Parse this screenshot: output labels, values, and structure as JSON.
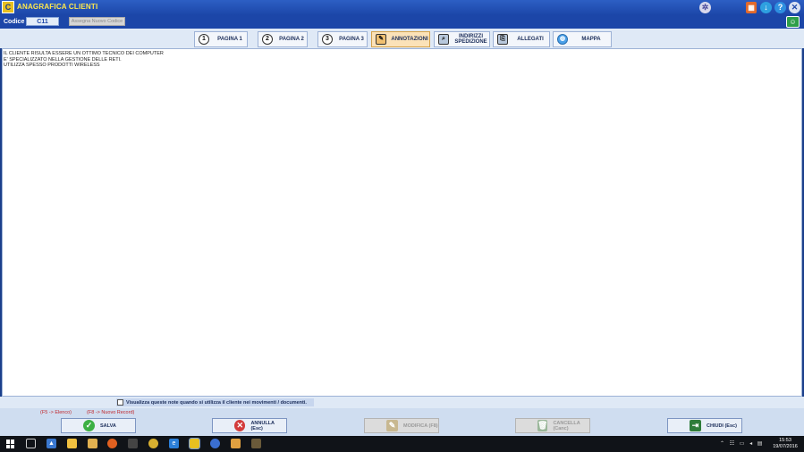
{
  "window": {
    "title": "ANAGRAFICA CLIENTI",
    "logo": "C"
  },
  "codebar": {
    "label": "Codice",
    "code_value": "C11",
    "assign_button": "Assegna Nuovo Codice"
  },
  "tabs": [
    {
      "label": "PAGINA 1",
      "icon": "1"
    },
    {
      "label": "PAGINA 2",
      "icon": "2"
    },
    {
      "label": "PAGINA 3",
      "icon": "3"
    },
    {
      "label": "ANNOTAZIONI",
      "icon": "notes-icon",
      "active": true
    },
    {
      "label": "INDIRIZZI\nSPEDIZIONE",
      "icon": "shipping-icon"
    },
    {
      "label": "ALLEGATI",
      "icon": "paperclip-icon"
    },
    {
      "label": "MAPPA",
      "icon": "globe-icon"
    }
  ],
  "notes": {
    "text": "IL CLIENTE RISULTA ESSERE UN OTTIMO TECNICO DEI COMPUTER\nE' SPECIALIZZATO NELLA GESTIONE DELLE RETI.\nUTILIZZA SPESSO PRODOTTI WIRELESS"
  },
  "checkbox": {
    "label": "Visualizza queste note quando si utilizza il cliente nei movimenti / documenti.",
    "checked": false
  },
  "footer": {
    "hint_list": "(F5 -> Elenco)",
    "hint_new": "(F8 -> Nuovo Record)",
    "save": "SALVA",
    "cancel": "ANNULLA (Esc)",
    "edit": "MODIFICA (F8)",
    "delete": "CANCELLA (Canc)",
    "close": "CHIUDI (Esc)"
  },
  "taskbar": {
    "time": "15:53",
    "date": "19/07/2016"
  },
  "colors": {
    "titlebar": "#1c46a8",
    "title_text": "#ffe94d",
    "active_tab": "#fbe2b8",
    "hint_text": "#c0282d"
  }
}
